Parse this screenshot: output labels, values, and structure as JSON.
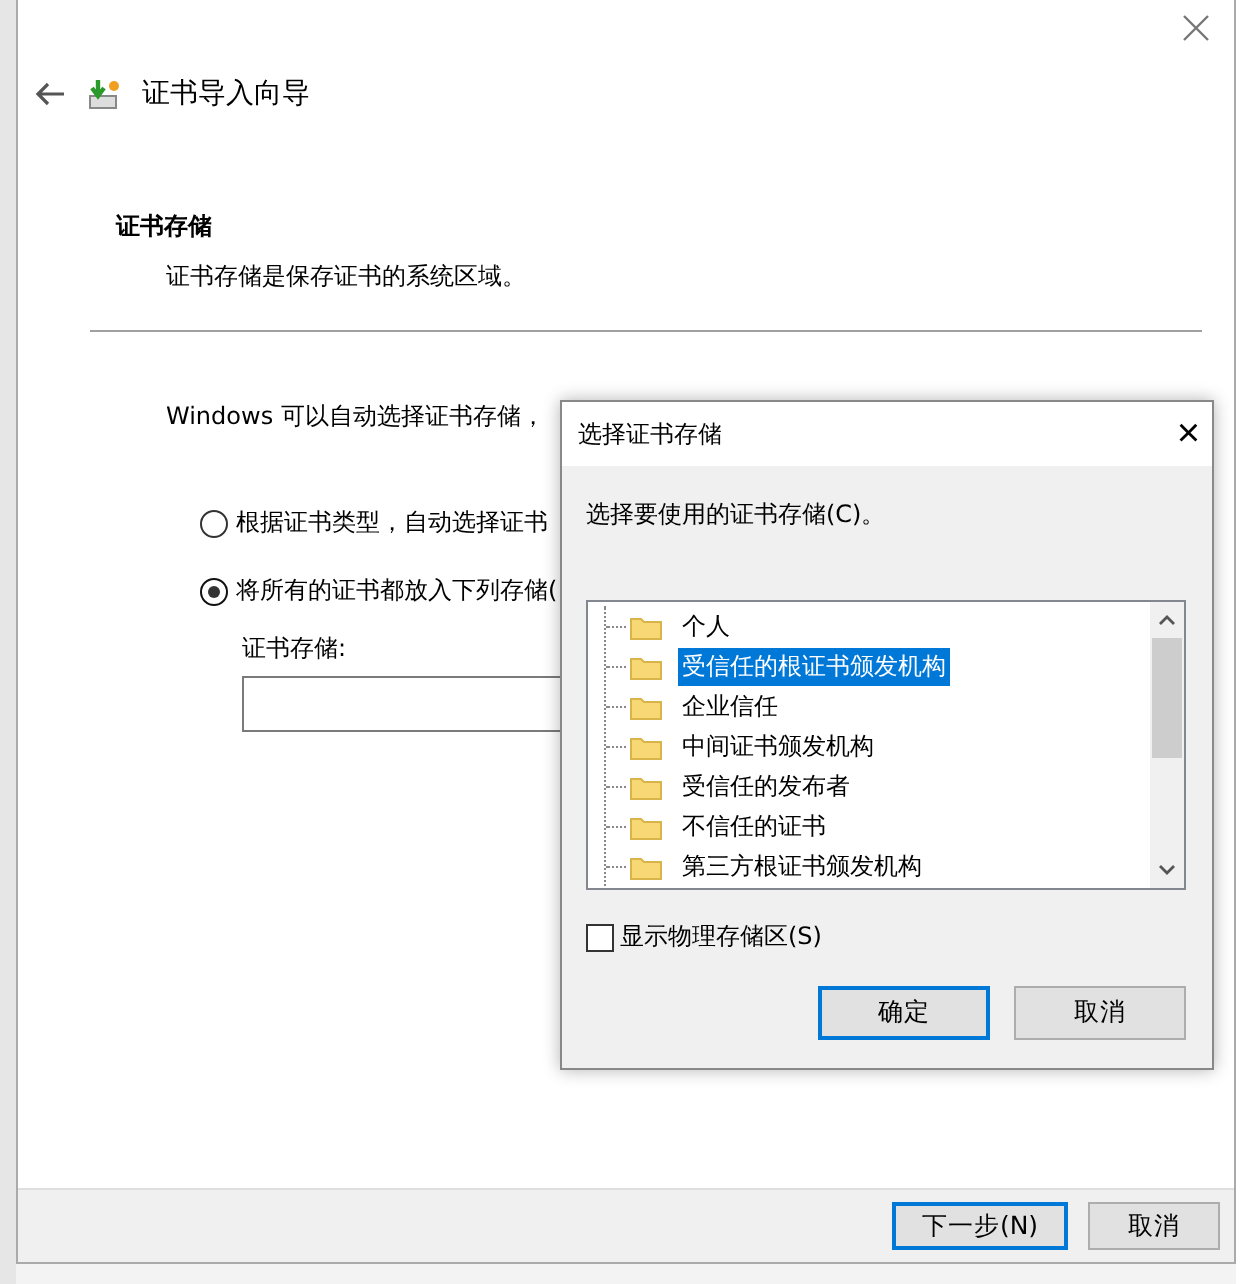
{
  "wizard": {
    "title": "证书导入向导",
    "heading": "证书存储",
    "description": "证书存储是保存证书的系统区域。",
    "intro": "Windows 可以自动选择证书存储，",
    "options": [
      {
        "label": "根据证书类型，自动选择证书",
        "selected": false
      },
      {
        "label": "将所有的证书都放入下列存储(",
        "selected": true
      }
    ],
    "store_label": "证书存储:",
    "buttons": [
      {
        "label": "下一步(N)",
        "default": true
      },
      {
        "label": "取消",
        "default": false
      }
    ]
  },
  "dialog": {
    "title": "选择证书存储",
    "close": "×",
    "prompt": "选择要使用的证书存储(C)。",
    "stores": [
      {
        "label": "个人",
        "selected": false
      },
      {
        "label": "受信任的根证书颁发机构",
        "selected": true
      },
      {
        "label": "企业信任",
        "selected": false
      },
      {
        "label": "中间证书颁发机构",
        "selected": false
      },
      {
        "label": "受信任的发布者",
        "selected": false
      },
      {
        "label": "不信任的证书",
        "selected": false
      },
      {
        "label": "第三方根证书颁发机构",
        "selected": false
      }
    ],
    "show_physical": {
      "label": "显示物理存储区(S)",
      "checked": false
    },
    "buttons": [
      {
        "label": "确定",
        "default": true
      },
      {
        "label": "取消",
        "default": false
      }
    ]
  }
}
